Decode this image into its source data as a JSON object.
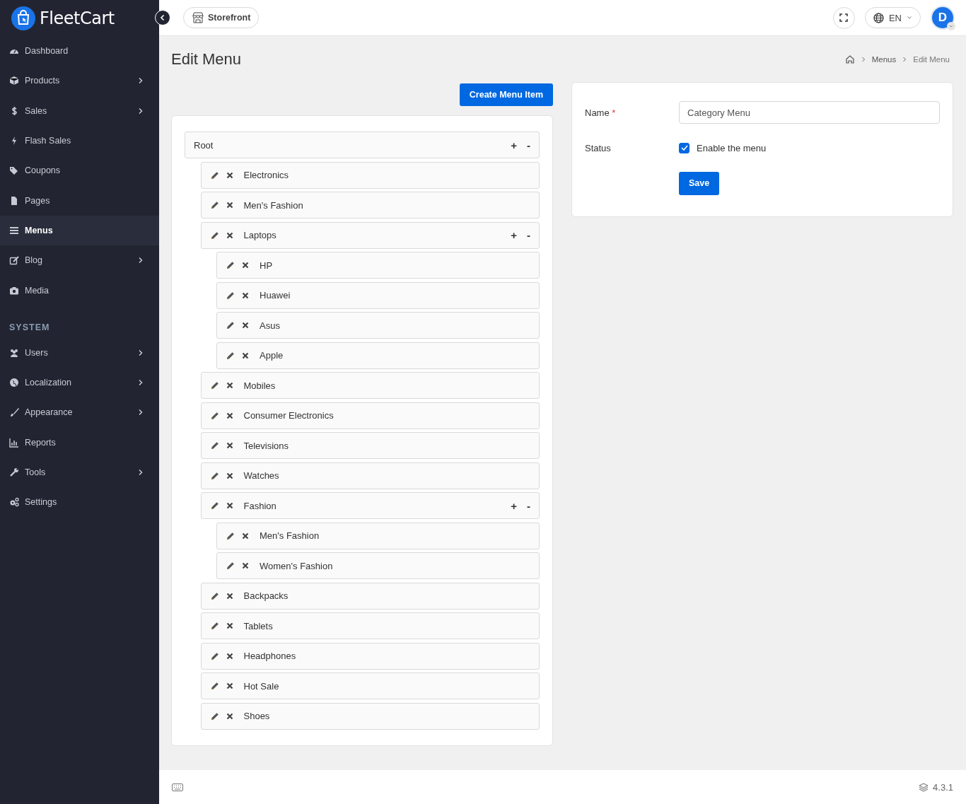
{
  "brand": {
    "name": "FleetCart"
  },
  "sidebar": {
    "items": [
      {
        "label": "Dashboard",
        "has_submenu": false,
        "selected": false
      },
      {
        "label": "Products",
        "has_submenu": true,
        "selected": false
      },
      {
        "label": "Sales",
        "has_submenu": true,
        "selected": false
      },
      {
        "label": "Flash Sales",
        "has_submenu": false,
        "selected": false
      },
      {
        "label": "Coupons",
        "has_submenu": false,
        "selected": false
      },
      {
        "label": "Pages",
        "has_submenu": false,
        "selected": false
      },
      {
        "label": "Menus",
        "has_submenu": false,
        "selected": true
      },
      {
        "label": "Blog",
        "has_submenu": true,
        "selected": false
      },
      {
        "label": "Media",
        "has_submenu": false,
        "selected": false
      }
    ],
    "system_heading": "SYSTEM",
    "system_items": [
      {
        "label": "Users",
        "has_submenu": true,
        "selected": false
      },
      {
        "label": "Localization",
        "has_submenu": true,
        "selected": false
      },
      {
        "label": "Appearance",
        "has_submenu": true,
        "selected": false
      },
      {
        "label": "Reports",
        "has_submenu": false,
        "selected": false
      },
      {
        "label": "Tools",
        "has_submenu": true,
        "selected": false
      },
      {
        "label": "Settings",
        "has_submenu": false,
        "selected": false
      }
    ]
  },
  "topbar": {
    "storefront": "Storefront",
    "language": "EN",
    "avatar": "D"
  },
  "page": {
    "title": "Edit Menu",
    "breadcrumbs": [
      "Menus",
      "Edit Menu"
    ]
  },
  "create_button": "Create Menu Item",
  "tree": {
    "label": "Root",
    "expand": "+",
    "collapse": "-",
    "children": [
      {
        "label": "Electronics"
      },
      {
        "label": "Men's Fashion"
      },
      {
        "label": "Laptops",
        "expand": "+",
        "collapse": "-",
        "children": [
          {
            "label": "HP"
          },
          {
            "label": "Huawei"
          },
          {
            "label": "Asus"
          },
          {
            "label": "Apple"
          }
        ]
      },
      {
        "label": "Mobiles"
      },
      {
        "label": "Consumer Electronics"
      },
      {
        "label": "Televisions"
      },
      {
        "label": "Watches"
      },
      {
        "label": "Fashion",
        "expand": "+",
        "collapse": "-",
        "children": [
          {
            "label": "Men's Fashion"
          },
          {
            "label": "Women's Fashion"
          }
        ]
      },
      {
        "label": "Backpacks"
      },
      {
        "label": "Tablets"
      },
      {
        "label": "Headphones"
      },
      {
        "label": "Hot Sale"
      },
      {
        "label": "Shoes"
      }
    ]
  },
  "form": {
    "name_label": "Name",
    "required_mark": "*",
    "name_value": "Category Menu",
    "status_label": "Status",
    "status_text": "Enable the menu",
    "checked": true,
    "save": "Save"
  },
  "footer": {
    "version": "4.3.1"
  }
}
